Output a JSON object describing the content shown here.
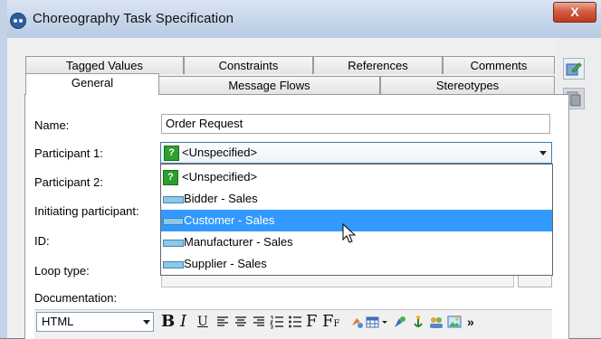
{
  "window": {
    "title": "Choreography Task Specification",
    "close_glyph": "X"
  },
  "tabs_row1": [
    "Tagged Values",
    "Constraints",
    "References",
    "Comments"
  ],
  "tabs_row2": [
    "General",
    "Message Flows",
    "Stereotypes"
  ],
  "form": {
    "name_label": "Name:",
    "name_value": "Order Request",
    "participant1_label": "Participant 1:",
    "participant1_value": "<Unspecified>",
    "participant2_label": "Participant 2:",
    "initiating_label": "Initiating participant:",
    "id_label": "ID:",
    "loop_label": "Loop type:",
    "documentation_label": "Documentation:"
  },
  "dropdown": {
    "items": [
      "<Unspecified>",
      "Bidder - Sales",
      "Customer - Sales",
      "Manufacturer - Sales",
      "Supplier - Sales"
    ],
    "selected_index": 2
  },
  "editor": {
    "format_value": "HTML",
    "bold": "B",
    "italic": "I",
    "underline": "U",
    "font": "F",
    "font_size": "F",
    "font_size_sub": "F",
    "more": "»"
  },
  "icons": [
    "app-logo-icon",
    "close-icon",
    "edit-icon",
    "copy-icon",
    "question-icon",
    "participant-icon",
    "mouse-cursor-icon"
  ]
}
